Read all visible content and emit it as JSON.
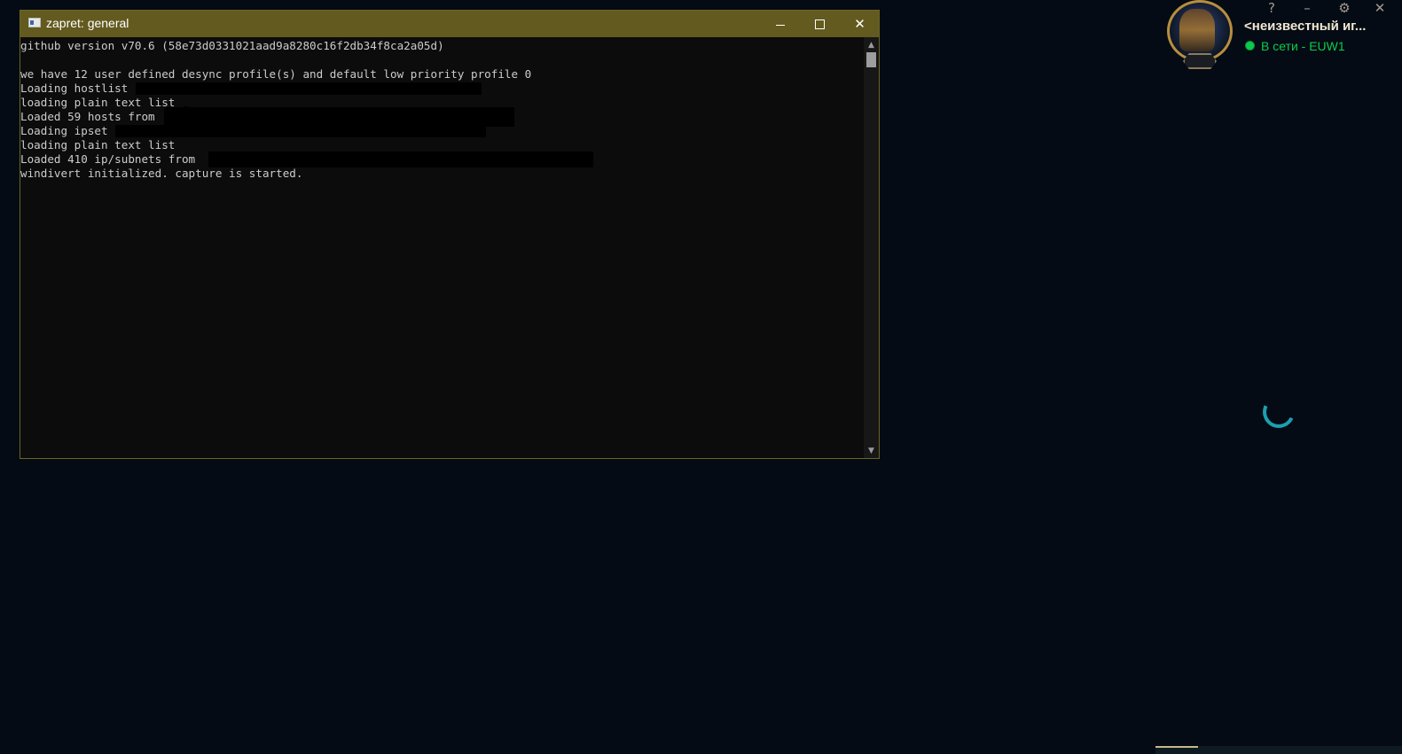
{
  "console": {
    "title": "zapret: general",
    "lines": [
      "github version v70.6 (58e73d0331021aad9a8280c16f2db34f8ca2a05d)",
      "",
      "we have 12 user defined desync profile(s) and default low priority profile 0",
      "Loading hostlist",
      "loading plain text list",
      "Loaded 59 hosts from",
      "Loading ipset",
      "loading plain text list",
      "Loaded 410 ip/subnets from",
      "windivert initialized. capture is started."
    ],
    "controls": {
      "minimize_icon": "minimize-icon",
      "maximize_icon": "maximize-icon",
      "close_glyph": "✕"
    },
    "scroll_up_glyph": "▲",
    "scroll_down_glyph": "▼"
  },
  "client": {
    "player_name": "<неизвестный иг...",
    "status": "В сети - EUW1",
    "status_color": "#0acb4a",
    "controls": {
      "help": "?",
      "minimize": "–",
      "settings": "⚙",
      "close": "✕"
    }
  }
}
